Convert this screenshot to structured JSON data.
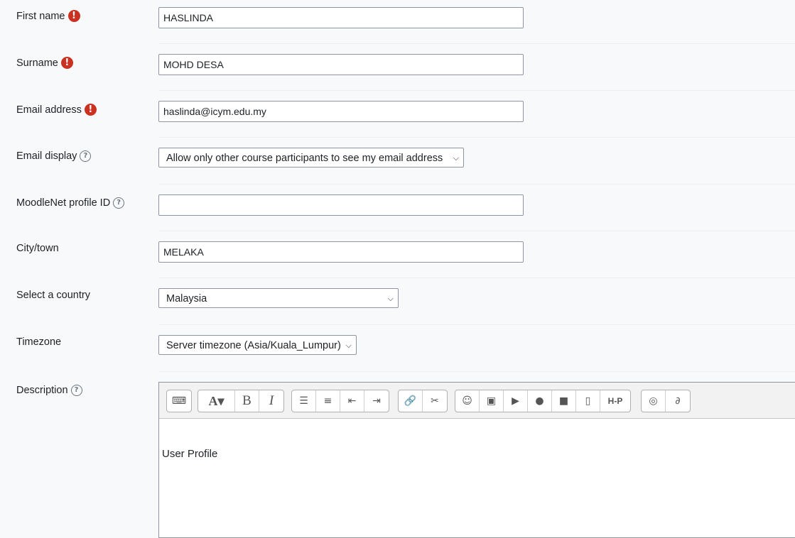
{
  "fields": {
    "first_name": {
      "label": "First name",
      "value": "HASLINDA"
    },
    "surname": {
      "label": "Surname",
      "value": "MOHD DESA"
    },
    "email": {
      "label": "Email address",
      "value": "haslinda@icym.edu.my"
    },
    "email_display": {
      "label": "Email display",
      "value": "Allow only other course participants to see my email address"
    },
    "moodlenet": {
      "label": "MoodleNet profile ID",
      "value": ""
    },
    "city": {
      "label": "City/town",
      "value": "MELAKA"
    },
    "country": {
      "label": "Select a country",
      "value": "Malaysia"
    },
    "timezone": {
      "label": "Timezone",
      "value": "Server timezone (Asia/Kuala_Lumpur)"
    },
    "description": {
      "label": "Description",
      "content": "User Profile"
    }
  },
  "icons": {
    "required": "exclamation-circle-icon",
    "help": "question-circle-icon"
  },
  "colors": {
    "required": "#ca3120",
    "background": "#f8f9fa"
  },
  "toolbar": {
    "groups": [
      [
        "toolbar-toggle-icon"
      ],
      [
        "font-style-icon",
        "bold-icon",
        "italic-icon"
      ],
      [
        "bullet-list-icon",
        "numbered-list-icon",
        "outdent-icon",
        "indent-icon"
      ],
      [
        "link-icon",
        "unlink-icon"
      ],
      [
        "emoji-icon",
        "image-icon",
        "media-icon",
        "record-audio-icon",
        "record-video-icon",
        "manage-files-icon",
        "h5p-icon"
      ],
      [
        "accessibility-checker-icon",
        "screenreader-helper-icon"
      ]
    ]
  }
}
